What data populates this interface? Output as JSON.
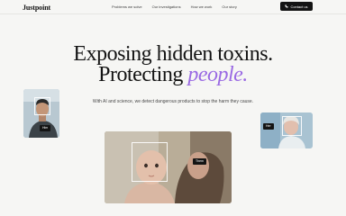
{
  "brand": {
    "name": "Justpoint"
  },
  "nav": {
    "links": [
      "Problems we solve",
      "Our investigations",
      "How we work",
      "Our story"
    ],
    "cta": "Contact us"
  },
  "hero": {
    "line1": "Exposing hidden toxins.",
    "line2_prefix": "Protecting ",
    "line2_accent": "people.",
    "subtitle": "With AI and science, we detect dangerous products to stop the harm they cause.",
    "accent_color": "#9a6ae3"
  },
  "cards": {
    "left_tag": "Him",
    "right_tag": "Her",
    "center_tag": "Them"
  }
}
